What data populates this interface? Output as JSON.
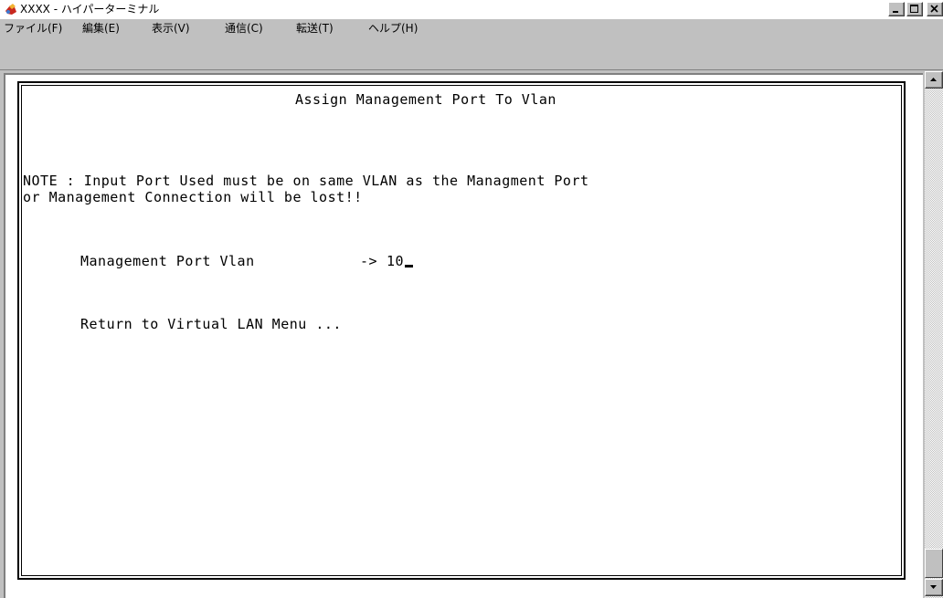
{
  "window": {
    "title": "XXXX - ハイパーターミナル",
    "controls": {
      "minimize": "minimize",
      "maximize": "maximize",
      "close": "close"
    }
  },
  "menu": {
    "items": [
      {
        "label": "ファイル(F)"
      },
      {
        "label": "編集(E)"
      },
      {
        "label": "表示(V)"
      },
      {
        "label": "通信(C)"
      },
      {
        "label": "転送(T)"
      },
      {
        "label": "ヘルプ(H)"
      }
    ]
  },
  "terminal": {
    "heading": "Assign Management Port To Vlan",
    "note_line1": "NOTE : Input Port Used must be on same VLAN as the Managment Port",
    "note_line2": "or Management Connection will be lost!!",
    "field_label": "Management Port Vlan",
    "field_arrow": "->",
    "field_value": "10",
    "return_item": "Return to Virtual LAN Menu ..."
  },
  "icons": {
    "app": "hyperterminal-icon",
    "scroll_up": "arrow-up-icon",
    "scroll_down": "arrow-down-icon"
  }
}
